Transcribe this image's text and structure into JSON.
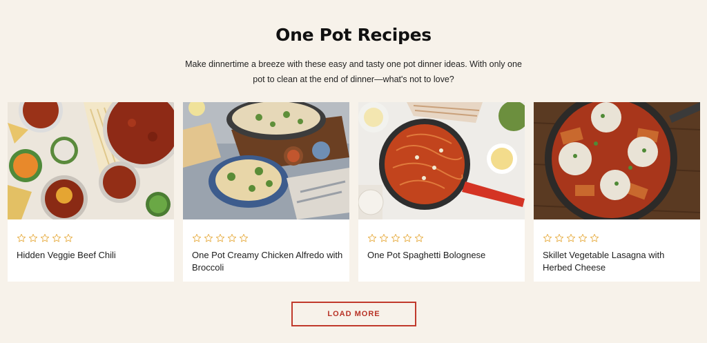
{
  "header": {
    "title": "One Pot Recipes",
    "description": "Make dinnertime a breeze with these easy and tasty one pot dinner ideas. With only one pot to clean at the end of dinner—what's not to love?"
  },
  "cards": [
    {
      "title": "Hidden Veggie Beef Chili",
      "rating": 0,
      "image": "beef-chili-photo"
    },
    {
      "title": "One Pot Creamy Chicken Alfredo with Broccoli",
      "rating": 0,
      "image": "chicken-alfredo-photo"
    },
    {
      "title": "One Pot Spaghetti Bolognese",
      "rating": 0,
      "image": "spaghetti-bolognese-photo"
    },
    {
      "title": "Skillet Vegetable Lasagna with Herbed Cheese",
      "rating": 0,
      "image": "vegetable-lasagna-photo"
    }
  ],
  "load_more": {
    "label": "LOAD MORE"
  },
  "colors": {
    "background": "#f7f2ea",
    "accent": "#c0392b",
    "star": "#e8b04a"
  },
  "icons": {
    "star": "star-outline-icon"
  }
}
